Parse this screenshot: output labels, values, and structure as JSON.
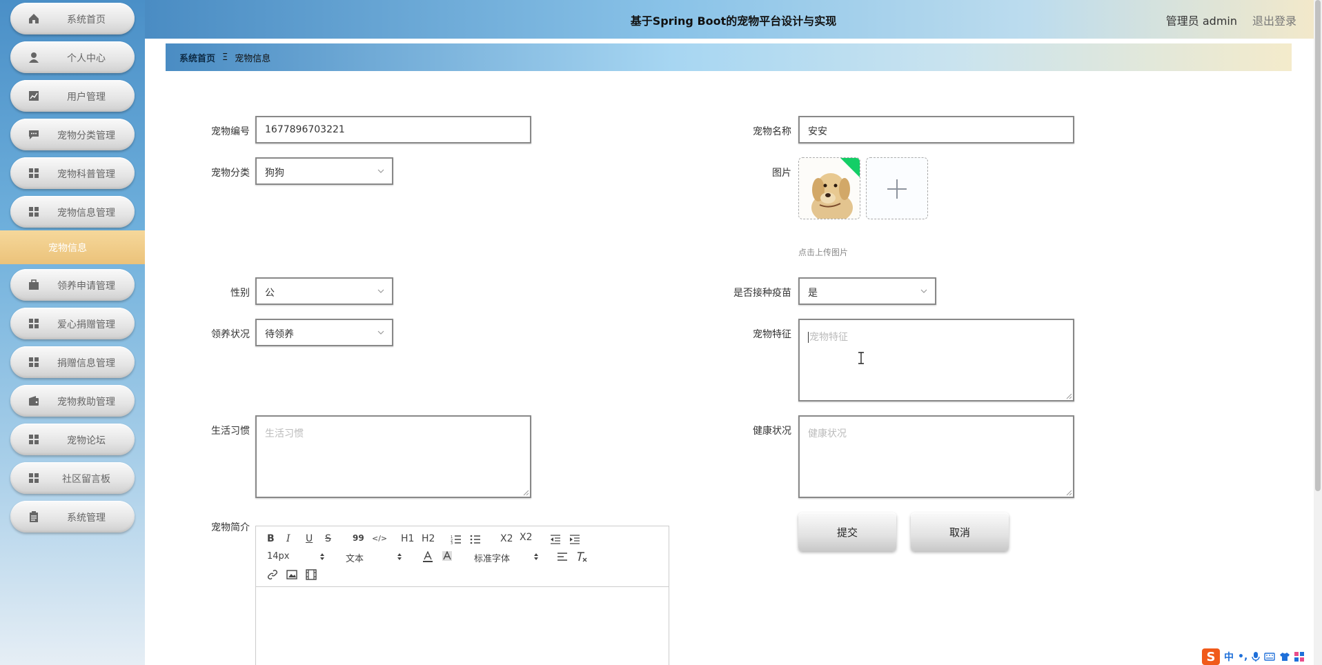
{
  "header": {
    "title": "基于Spring Boot的宠物平台设计与实现",
    "user": "管理员 admin",
    "logout": "退出登录"
  },
  "sidebar": {
    "items": [
      {
        "label": "系统首页",
        "icon": "home-icon"
      },
      {
        "label": "个人中心",
        "icon": "user-icon"
      },
      {
        "label": "用户管理",
        "icon": "chart-icon"
      },
      {
        "label": "宠物分类管理",
        "icon": "chat-icon"
      },
      {
        "label": "宠物科普管理",
        "icon": "grid-icon"
      },
      {
        "label": "宠物信息管理",
        "icon": "grid-icon"
      },
      {
        "label": "领养申请管理",
        "icon": "briefcase-icon"
      },
      {
        "label": "爱心捐赠管理",
        "icon": "grid-icon"
      },
      {
        "label": "捐赠信息管理",
        "icon": "grid-icon"
      },
      {
        "label": "宠物救助管理",
        "icon": "wallet-icon"
      },
      {
        "label": "宠物论坛",
        "icon": "grid-icon"
      },
      {
        "label": "社区留言板",
        "icon": "grid-icon"
      },
      {
        "label": "系统管理",
        "icon": "clipboard-icon"
      }
    ],
    "active_sub": "宠物信息"
  },
  "breadcrumb": {
    "home": "系统首页",
    "sep": "Ξ",
    "current": "宠物信息"
  },
  "form": {
    "pet_id": {
      "label": "宠物编号",
      "value": "1677896703221"
    },
    "pet_name": {
      "label": "宠物名称",
      "value": "安安"
    },
    "category": {
      "label": "宠物分类",
      "value": "狗狗"
    },
    "image": {
      "label": "图片",
      "tip": "点击上传图片"
    },
    "gender": {
      "label": "性别",
      "value": "公"
    },
    "vaccinated": {
      "label": "是否接种疫苗",
      "value": "是"
    },
    "adopt_status": {
      "label": "领养状况",
      "value": "待领养"
    },
    "features": {
      "label": "宠物特征",
      "placeholder": "宠物特征"
    },
    "habits": {
      "label": "生活习惯",
      "placeholder": "生活习惯"
    },
    "health": {
      "label": "健康状况",
      "placeholder": "健康状况"
    },
    "intro": {
      "label": "宠物简介"
    },
    "submit": "提交",
    "cancel": "取消"
  },
  "editor": {
    "bold": "B",
    "italic": "I",
    "underline": "U",
    "strike": "S",
    "quote": "99",
    "code": "</>",
    "h1": "H1",
    "h2": "H2",
    "sub": "X2",
    "sup": "X2",
    "font_size": "14px",
    "text_type": "文本",
    "font_family": "标准字体"
  },
  "ime": {
    "lang": "中"
  }
}
